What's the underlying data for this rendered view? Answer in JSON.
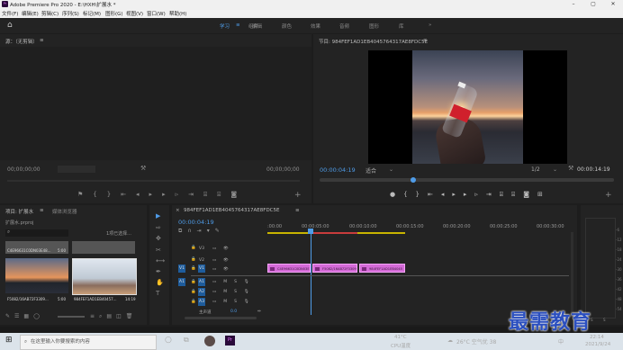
{
  "window": {
    "title": "Adobe Premiere Pro 2020 - E:\\HXH\\扩展水 *",
    "logo_text": "Pr"
  },
  "menu": [
    "文件(F)",
    "编辑(E)",
    "剪辑(C)",
    "序列(S)",
    "标记(M)",
    "图形(G)",
    "视图(V)",
    "窗口(W)",
    "帮助(H)"
  ],
  "workspaces": {
    "items": [
      "学习",
      "组件",
      "编辑",
      "颜色",
      "效果",
      "音频",
      "图形",
      "库"
    ],
    "active": "学习",
    "more": "»"
  },
  "source": {
    "title": "源：（无剪辑）",
    "tc_left": "00;00;00;00",
    "page_box": "",
    "tc_right": "00;00;00;00"
  },
  "program": {
    "title": "节目: 984FEF1AD1EB4045764317AE8FDC5E",
    "timecode": "00:00:04:19",
    "fit": "适合",
    "ratio": "1/2",
    "duration": "00:00:14:19"
  },
  "project": {
    "tab1": "项目: 扩展水",
    "tab2": "媒体浏览器",
    "file": "扩展水.prproj",
    "count": "1项已选择...",
    "items": [
      {
        "name": "C4E96631C0DN03E48...",
        "dur": "5:00"
      },
      {
        "name": "F5082/16AB72F3309...",
        "dur": "5:00"
      },
      {
        "name": "984FEF1AD1EB40457...",
        "dur": "14:19"
      }
    ]
  },
  "timeline": {
    "title": "984FEF1AD1EB4045764317AE8FDC5E",
    "timecode": "00:00:04:19",
    "ruler": [
      ":00:00",
      "00:00:05:00",
      "00:00:10:00",
      "00:00:15:00",
      "00:00:20:00",
      "00:00:25:00",
      "00:00:30:00"
    ],
    "video_tracks": [
      "V3",
      "V2",
      "V1"
    ],
    "audio_tracks": [
      "A1",
      "A2",
      "A3"
    ],
    "master_label": "主声道",
    "master_val": "0.0",
    "clips": [
      "C4E96631C0DN03E",
      "F5082/16AB72F3309",
      "984FEF1AD1EB4045"
    ]
  },
  "meter": {
    "ticks": [
      "-6",
      "-12",
      "-18",
      "-24",
      "-30",
      "-36",
      "-42",
      "-48",
      "-54"
    ],
    "labels": [
      "S",
      "S"
    ]
  },
  "taskbar": {
    "search_placeholder": "在这里输入你要搜索的内容",
    "cpu_temp": "41°C",
    "cpu_label": "CPU温度",
    "weather": "26°C 空气优 38",
    "ime": "中",
    "time": "22:14",
    "date": "2021/9/24"
  },
  "watermark": "最需教育"
}
